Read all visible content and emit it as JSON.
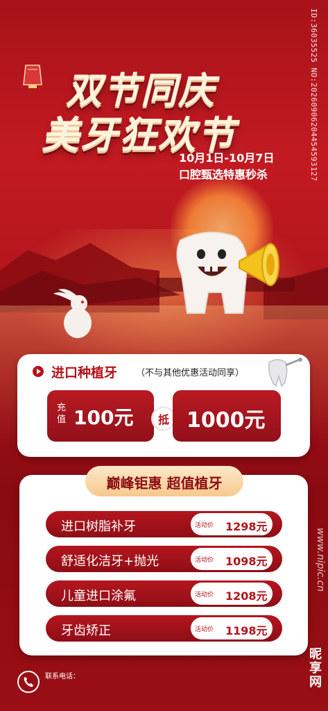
{
  "title_line1": "双节同庆",
  "title_line2": "美牙狂欢节",
  "date_text": "10月1日-10月7日",
  "subtitle": "口腔甄选特惠秒杀",
  "vertical_id": "ID:36035525 NO:20260906204454593127",
  "card1": {
    "title": "进口种植牙",
    "note": "（不与其他优惠活动同享）",
    "recharge_label": "充值",
    "recharge_value": "100元",
    "deduct_label": "抵",
    "deduct_value": "1000元"
  },
  "card2": {
    "ribbon": "巅峰钜惠  超值植牙",
    "items": [
      {
        "name": "进口树脂补牙",
        "tag": "活动价",
        "price": "1298元"
      },
      {
        "name": "舒适化洁牙+抛光",
        "tag": "活动价",
        "price": "1098元"
      },
      {
        "name": "儿童进口涂氟",
        "tag": "活动价",
        "price": "1208元"
      },
      {
        "name": "牙齿矫正",
        "tag": "活动价",
        "price": "1198元"
      }
    ]
  },
  "contact_label": "联系电话：",
  "watermark": "www.nipic.cn",
  "brand": "昵享网",
  "colors": {
    "primary_red": "#b3131b",
    "cream": "#fff3dc",
    "gold": "#f6c98f"
  }
}
